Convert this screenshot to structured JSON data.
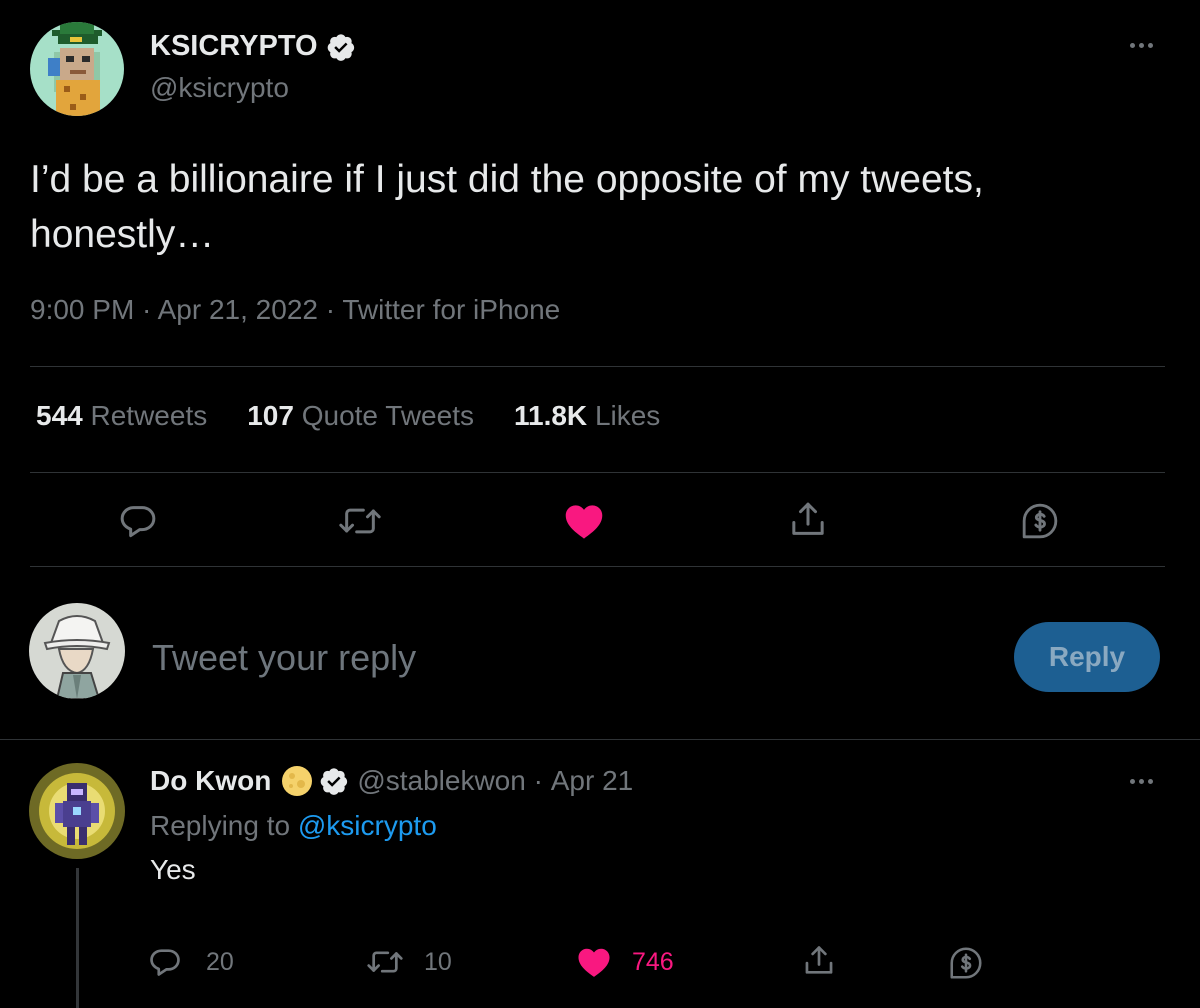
{
  "tweet": {
    "author": {
      "display_name": "KSICRYPTO",
      "handle": "@ksicrypto",
      "verified": true,
      "avatar": "pixel-ape-avatar"
    },
    "text": "I’d be a billionaire if I just did the opposite of my tweets, honestly…",
    "time": "9:00 PM",
    "date": "Apr 21, 2022",
    "source": "Twitter for iPhone",
    "separator": " · ",
    "stats": {
      "retweets_count": "544",
      "retweets_label": "Retweets",
      "quotes_count": "107",
      "quotes_label": "Quote Tweets",
      "likes_count": "11.8K",
      "likes_label": "Likes"
    },
    "actions": [
      "reply-icon",
      "retweet-icon",
      "heart-icon",
      "share-icon",
      "tip-icon"
    ],
    "liked": true
  },
  "composer": {
    "placeholder": "Tweet your reply",
    "value": "",
    "button_label": "Reply",
    "avatar": "bucket-hat-avatar"
  },
  "reply": {
    "display_name": "Do Kwon",
    "emoji": "moon-icon",
    "verified": true,
    "handle": "@stablekwon",
    "date": "Apr 21",
    "separator": " · ",
    "replying_prefix": "Replying to",
    "replying_to": "@ksicrypto",
    "text": "Yes",
    "stats": {
      "replies": "20",
      "retweets": "10",
      "likes": "746"
    },
    "avatar": "robot-avatar"
  },
  "colors": {
    "background": "#000000",
    "text": "#e7e9ea",
    "muted": "#71767b",
    "link": "#1d9bf0",
    "like": "#f91880",
    "reply_button": "#1d5f92",
    "divider": "#2f3336"
  }
}
